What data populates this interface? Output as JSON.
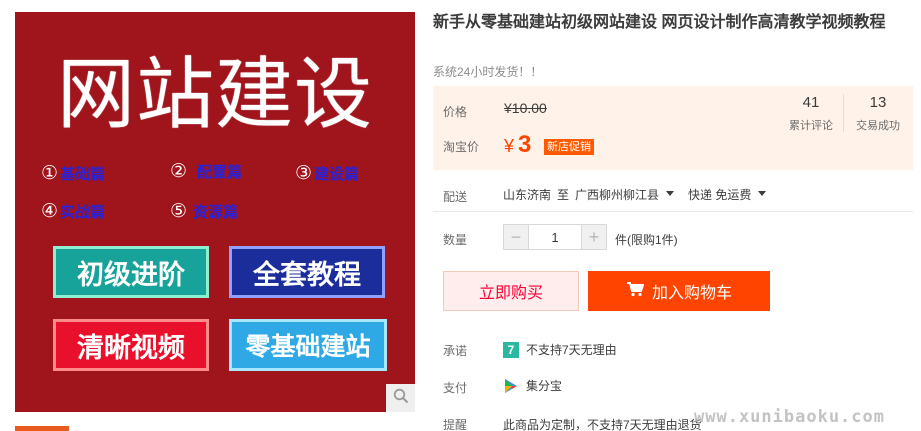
{
  "product_image": {
    "title": "网站建设",
    "chapters": [
      {
        "num": "①",
        "label": "基础篇"
      },
      {
        "num": "②",
        "label": "配置篇"
      },
      {
        "num": "③",
        "label": "建设篇"
      },
      {
        "num": "④",
        "label": "实战篇"
      },
      {
        "num": "⑤",
        "label": "资源篇"
      }
    ],
    "buttons": [
      "初级进阶",
      "全套教程",
      "清晰视频",
      "零基础建站"
    ]
  },
  "title": "新手从零基础建站初级网站建设 网页设计制作高清教学视频教程",
  "subtitle": "系统24小时发货！！",
  "price": {
    "label": "价格",
    "original": "¥10.00",
    "taobao_label": "淘宝价",
    "currency": "¥",
    "sale": "3",
    "promo_tag": "新店促销"
  },
  "stats": [
    {
      "value": "41",
      "label": "累计评论"
    },
    {
      "value": "13",
      "label": "交易成功"
    }
  ],
  "shipping": {
    "label": "配送",
    "from": "山东济南",
    "to_word": "至",
    "destination": "广西柳州柳江县",
    "method": "快递 免运费"
  },
  "quantity": {
    "label": "数量",
    "value": "1",
    "minus": "−",
    "plus": "+",
    "limit": "件(限购1件)"
  },
  "actions": {
    "buy_now": "立即购买",
    "add_cart": "加入购物车"
  },
  "services": {
    "promise_label": "承诺",
    "promise_icon_text": "7",
    "promise_text": "不支持7天无理由",
    "pay_label": "支付",
    "pay_text": "集分宝",
    "note_label": "提醒",
    "note_text": "此商品为定制，不支持7天无理由退货"
  },
  "watermark": "www.xunibaoku.com",
  "colors": {
    "accent": "#ff4400",
    "image_bg": "#a0141c",
    "price_panel": "#fff2e8",
    "promise_badge": "#2bb8a0"
  },
  "icons": [
    "zoom-icon",
    "cart-icon",
    "caret-down-icon",
    "seven-day-badge-icon",
    "points-icon"
  ]
}
